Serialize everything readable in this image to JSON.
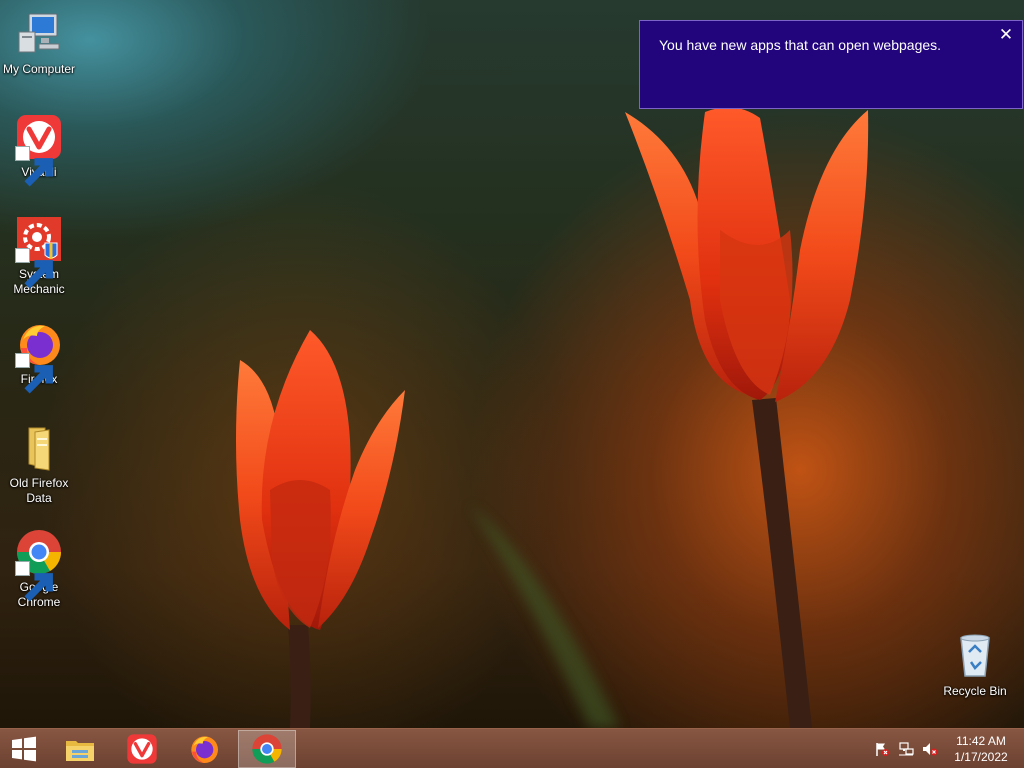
{
  "desktop": {
    "icons": [
      {
        "label": "My Computer",
        "icon": "computer-icon"
      },
      {
        "label": "Vivaldi",
        "icon": "vivaldi-icon"
      },
      {
        "label": "System Mechanic",
        "icon": "system-mechanic-icon"
      },
      {
        "label": "Firefox",
        "icon": "firefox-icon"
      },
      {
        "label": "Old Firefox Data",
        "icon": "folder-icon"
      },
      {
        "label": "Google Chrome",
        "icon": "chrome-icon"
      }
    ],
    "recycle_bin": {
      "label": "Recycle Bin",
      "icon": "recycle-bin-icon"
    }
  },
  "notification": {
    "message": "You have new apps that can open webpages.",
    "close_glyph": "✕",
    "background": "#22057c"
  },
  "taskbar": {
    "pinned": [
      {
        "name": "start",
        "icon": "windows-logo-icon"
      },
      {
        "name": "file-explorer",
        "icon": "file-explorer-icon"
      },
      {
        "name": "vivaldi",
        "icon": "vivaldi-icon"
      },
      {
        "name": "firefox",
        "icon": "firefox-icon"
      },
      {
        "name": "chrome",
        "icon": "chrome-icon",
        "active": true
      }
    ],
    "tray": [
      "action-center-flag-icon",
      "network-icon",
      "volume-muted-icon"
    ],
    "clock": {
      "time": "11:42 AM",
      "date": "1/17/2022"
    }
  }
}
